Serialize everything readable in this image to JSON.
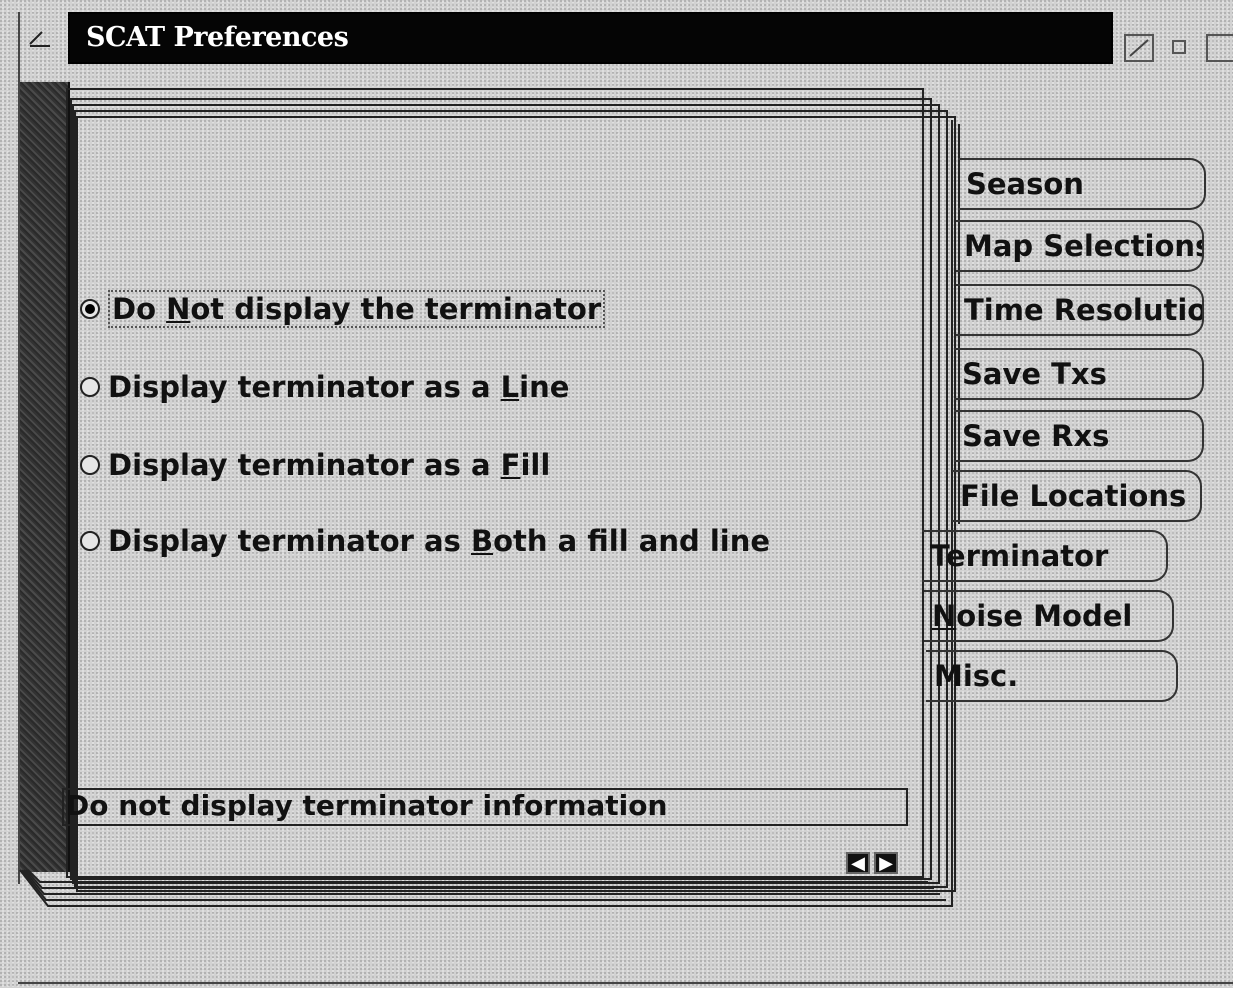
{
  "window": {
    "title": "SCAT Preferences"
  },
  "options": [
    {
      "pre": "Do ",
      "mn": "N",
      "post": "ot display the terminator",
      "selected": true
    },
    {
      "pre": "Display terminator as a ",
      "mn": "L",
      "post": "ine",
      "selected": false
    },
    {
      "pre": "Display terminator as a ",
      "mn": "F",
      "post": "ill",
      "selected": false
    },
    {
      "pre": "Display terminator as ",
      "mn": "B",
      "post": "oth a fill and line",
      "selected": false
    }
  ],
  "status": "Do not display terminator information",
  "tabs": {
    "season": "Season",
    "map_selections": "Map Selections",
    "time_resolution": "Time Resolutio",
    "save_txs": "Save Txs",
    "save_rxs": "Save Rxs",
    "file_locations": "File Locations",
    "terminator": "Terminator",
    "noise_model_mn": "N",
    "noise_model_rest": "oise Model",
    "misc": "Misc."
  },
  "icons": {
    "system_menu": "system-menu-icon",
    "maximize": "maximize-icon",
    "minimize": "minimize-icon",
    "prev_page": "left-arrow-icon",
    "next_page": "right-arrow-icon"
  }
}
